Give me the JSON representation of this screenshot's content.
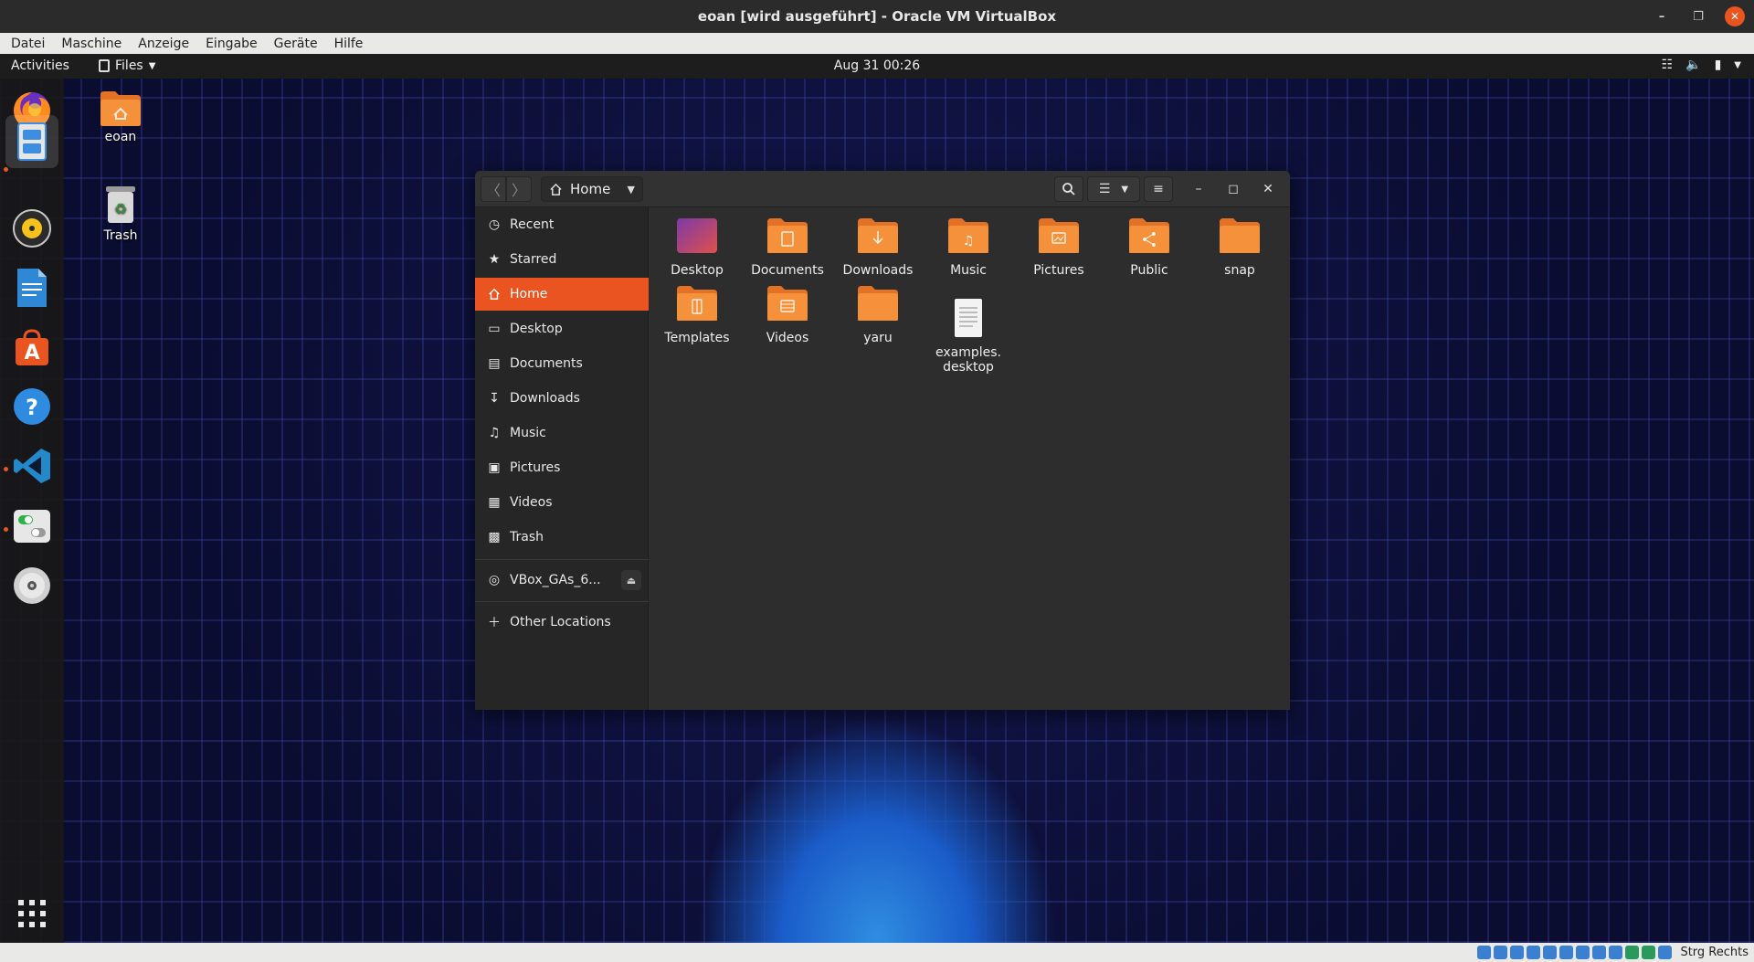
{
  "host": {
    "window_title": "eoan [wird ausgeführt] - Oracle VM VirtualBox",
    "menu": [
      "Datei",
      "Maschine",
      "Anzeige",
      "Eingabe",
      "Geräte",
      "Hilfe"
    ],
    "host_key_label": "Strg Rechts"
  },
  "topbar": {
    "activities": "Activities",
    "app_name": "Files",
    "clock": "Aug 31  00:26"
  },
  "dock": {
    "items": [
      "firefox-icon",
      "files-icon",
      "rhythmbox-icon",
      "libreoffice-writer-icon",
      "software-icon",
      "help-icon",
      "vscode-icon",
      "settings-icon",
      "disc-icon",
      "show-apps-icon"
    ]
  },
  "desktop": {
    "icons": [
      {
        "label": "eoan",
        "icon": "home-folder-icon"
      },
      {
        "label": "Trash",
        "icon": "trash-icon"
      }
    ]
  },
  "file_manager": {
    "location": "Home",
    "sidebar": [
      {
        "label": "Recent",
        "icon": "clock-icon"
      },
      {
        "label": "Starred",
        "icon": "star-icon"
      },
      {
        "label": "Home",
        "icon": "home-icon",
        "selected": true
      },
      {
        "label": "Desktop",
        "icon": "desktop-icon"
      },
      {
        "label": "Documents",
        "icon": "document-icon"
      },
      {
        "label": "Downloads",
        "icon": "download-icon"
      },
      {
        "label": "Music",
        "icon": "music-icon"
      },
      {
        "label": "Pictures",
        "icon": "picture-icon"
      },
      {
        "label": "Videos",
        "icon": "video-icon"
      },
      {
        "label": "Trash",
        "icon": "trash-icon"
      },
      {
        "label": "VBox_GAs_6...",
        "icon": "disc-icon"
      },
      {
        "label": "Other Locations",
        "icon": "plus-icon"
      }
    ],
    "files": [
      {
        "name": "Desktop",
        "icon": "desktop-folder-icon"
      },
      {
        "name": "Documents",
        "icon": "documents-folder-icon"
      },
      {
        "name": "Downloads",
        "icon": "downloads-folder-icon"
      },
      {
        "name": "Music",
        "icon": "music-folder-icon"
      },
      {
        "name": "Pictures",
        "icon": "pictures-folder-icon"
      },
      {
        "name": "Public",
        "icon": "public-folder-icon"
      },
      {
        "name": "snap",
        "icon": "folder-icon"
      },
      {
        "name": "Templates",
        "icon": "templates-folder-icon"
      },
      {
        "name": "Videos",
        "icon": "videos-folder-icon"
      },
      {
        "name": "yaru",
        "icon": "folder-icon"
      },
      {
        "name": "examples.\ndesktop",
        "icon": "text-file-icon"
      }
    ]
  },
  "colors": {
    "accent": "#e95420",
    "folder": "#f5913a",
    "folder_dark": "#e47226",
    "panel": "#1d1d1d",
    "sidebar": "#262626",
    "content": "#2d2d2d"
  }
}
